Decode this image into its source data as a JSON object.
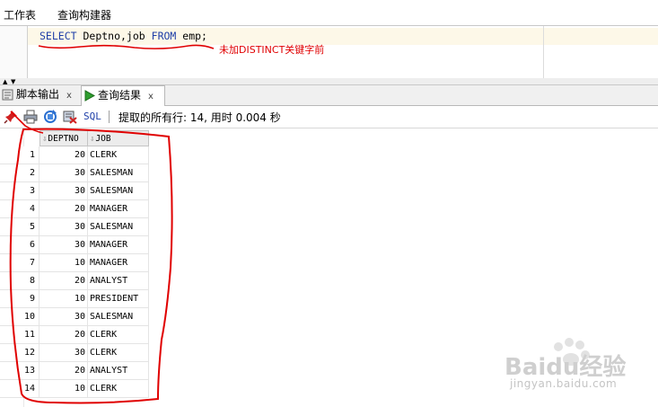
{
  "top_tabs": {
    "worksheet": "工作表",
    "query_builder": "查询构建器"
  },
  "editor": {
    "sql_keyword_select": "SELECT",
    "sql_columns": " Deptno,job ",
    "sql_keyword_from": "FROM",
    "sql_rest": " emp;",
    "annotation": "未加DISTINCT关键字前"
  },
  "result_tabs": {
    "script_output": "脚本输出",
    "query_result": "查询结果",
    "close": "x"
  },
  "toolbar": {
    "sql_label": "SQL",
    "fetch_status": "提取的所有行: 14, 用时 0.004 秒"
  },
  "grid": {
    "columns": [
      "DEPTNO",
      "JOB"
    ],
    "rows": [
      {
        "n": "1",
        "deptno": "20",
        "job": "CLERK"
      },
      {
        "n": "2",
        "deptno": "30",
        "job": "SALESMAN"
      },
      {
        "n": "3",
        "deptno": "30",
        "job": "SALESMAN"
      },
      {
        "n": "4",
        "deptno": "20",
        "job": "MANAGER"
      },
      {
        "n": "5",
        "deptno": "30",
        "job": "SALESMAN"
      },
      {
        "n": "6",
        "deptno": "30",
        "job": "MANAGER"
      },
      {
        "n": "7",
        "deptno": "10",
        "job": "MANAGER"
      },
      {
        "n": "8",
        "deptno": "20",
        "job": "ANALYST"
      },
      {
        "n": "9",
        "deptno": "10",
        "job": "PRESIDENT"
      },
      {
        "n": "10",
        "deptno": "30",
        "job": "SALESMAN"
      },
      {
        "n": "11",
        "deptno": "20",
        "job": "CLERK"
      },
      {
        "n": "12",
        "deptno": "30",
        "job": "CLERK"
      },
      {
        "n": "13",
        "deptno": "20",
        "job": "ANALYST"
      },
      {
        "n": "14",
        "deptno": "10",
        "job": "CLERK"
      }
    ]
  },
  "watermark": {
    "brand": "Baidu经验",
    "url": "jingyan.baidu.com"
  },
  "colors": {
    "annotation_red": "#e00000",
    "keyword_blue": "#1f3fa8"
  }
}
